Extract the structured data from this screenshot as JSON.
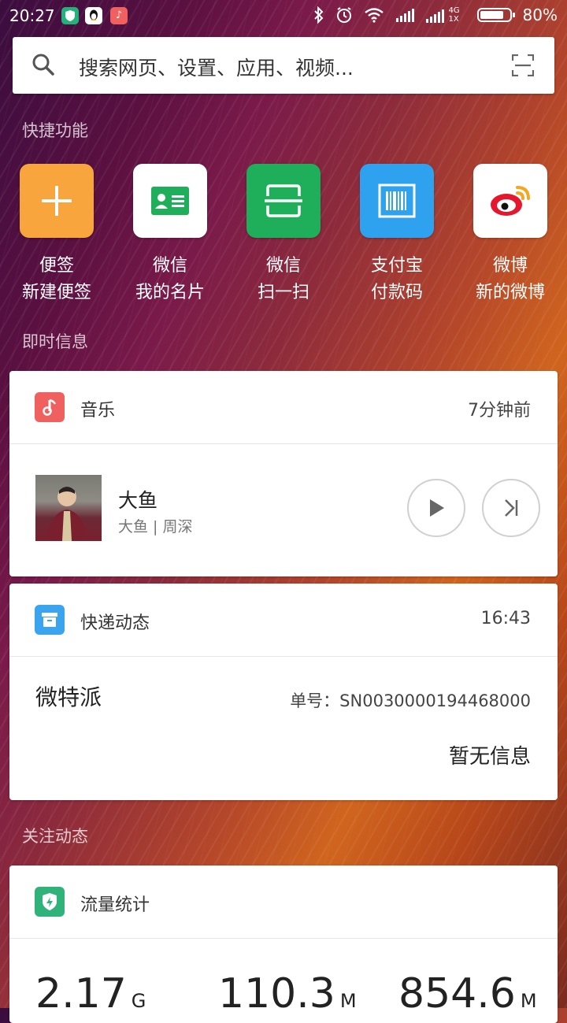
{
  "status_bar": {
    "time": "20:27",
    "battery": "80%",
    "battery_level": 0.8,
    "network_label_top": "4G",
    "network_label_bottom": "1X",
    "notification_icons": [
      "shield-app-icon",
      "qq-penguin-icon",
      "music-app-icon"
    ]
  },
  "search": {
    "placeholder": "搜索网页、设置、应用、视频..."
  },
  "sections": {
    "shortcuts": "快捷功能",
    "instant": "即时信息",
    "follow": "关注动态"
  },
  "shortcuts": [
    {
      "line1": "便签",
      "line2": "新建便签",
      "color": "#f7a53c",
      "icon": "plus-icon"
    },
    {
      "line1": "微信",
      "line2": "我的名片",
      "color": "#ffffff",
      "icon": "contact-card-icon"
    },
    {
      "line1": "微信",
      "line2": "扫一扫",
      "color": "#1fae5a",
      "icon": "scan-frame-icon"
    },
    {
      "line1": "支付宝",
      "line2": "付款码",
      "color": "#2ea2ef",
      "icon": "barcode-icon"
    },
    {
      "line1": "微博",
      "line2": "新的微博",
      "color": "#ffffff",
      "icon": "weibo-icon"
    }
  ],
  "music_card": {
    "title": "音乐",
    "time": "7分钟前",
    "song": "大鱼",
    "artist": "大鱼 | 周深",
    "accent": "#f0605e"
  },
  "express_card": {
    "title": "快递动态",
    "time": "16:43",
    "shop": "微特派",
    "tracking": "单号：SN0030000194468000",
    "status": "暂无信息",
    "accent": "#3aa4ee"
  },
  "traffic_card": {
    "title": "流量统计",
    "accent": "#2fb37a",
    "values": [
      {
        "value": "2.17",
        "unit": "G"
      },
      {
        "value": "110.3",
        "unit": "M"
      },
      {
        "value": "854.6",
        "unit": "M"
      }
    ]
  }
}
